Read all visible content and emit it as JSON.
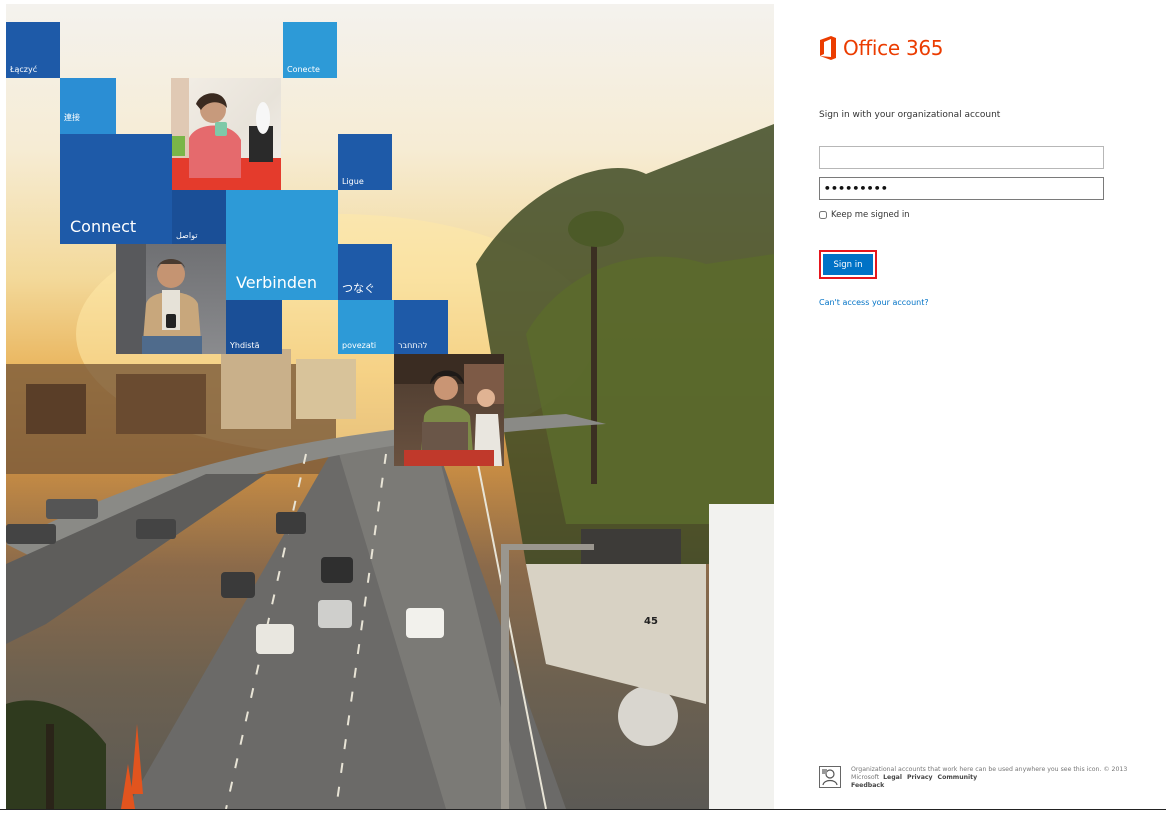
{
  "hero": {
    "tiles": {
      "laczyc": "Łączyć",
      "conecte": "Conecte",
      "lianjie": "連接",
      "connect": "Connect",
      "tawasal": "تواصل",
      "ligue": "Ligue",
      "verbinden": "Verbinden",
      "tsunagu": "つなぐ",
      "yhdista": "Yhdistä",
      "povezati": "povezati",
      "lehitchaber": "להתחבר"
    },
    "speed_sign": "45"
  },
  "signin": {
    "brand": "Office 365",
    "brand_color": "#eb3c00",
    "prompt": "Sign in with your organizational account",
    "username_value": "",
    "password_value": "•••••••••",
    "keep_signed_in_label": "Keep me signed in",
    "keep_signed_in_checked": false,
    "sign_in_label": "Sign in",
    "cant_access_label": "Can't access your account?",
    "accent_color": "#0072c6"
  },
  "footer": {
    "icon": "organizational-account-icon",
    "text": "Organizational accounts that work here can be used anywhere you see this icon. © 2013 Microsoft",
    "links": [
      "Legal",
      "Privacy",
      "Community",
      "Feedback"
    ]
  }
}
